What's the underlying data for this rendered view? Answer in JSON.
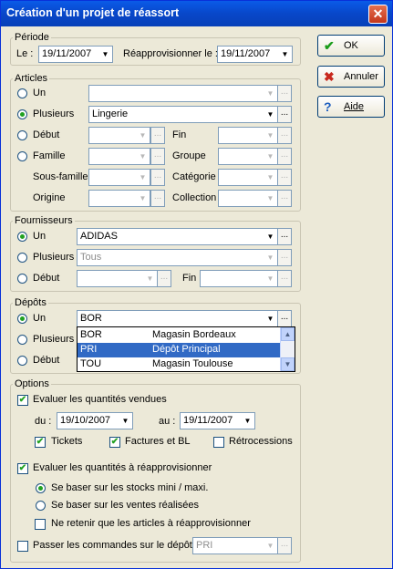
{
  "window": {
    "title": "Création d'un projet de réassort",
    "close_label": "✕"
  },
  "buttons": {
    "ok": "OK",
    "cancel": "Annuler",
    "help": "Aide"
  },
  "periode": {
    "title": "Période",
    "le_label": "Le :",
    "le_value": "19/11/2007",
    "reappro_label": "Réapprovisionner le :",
    "reappro_value": "19/11/2007"
  },
  "articles": {
    "title": "Articles",
    "un": "Un",
    "plusieurs": "Plusieurs",
    "plusieurs_value": "Lingerie",
    "debut": "Début",
    "fin": "Fin",
    "famille": "Famille",
    "groupe": "Groupe",
    "sous_famille": "Sous-famille",
    "categorie": "Catégorie",
    "origine": "Origine",
    "collection": "Collection",
    "selected": "plusieurs"
  },
  "fournisseurs": {
    "title": "Fournisseurs",
    "un": "Un",
    "un_value": "ADIDAS",
    "plusieurs": "Plusieurs",
    "plusieurs_value": "Tous",
    "debut": "Début",
    "fin": "Fin",
    "selected": "un"
  },
  "depots": {
    "title": "Dépôts",
    "un": "Un",
    "un_value": "BOR",
    "plusieurs": "Plusieurs",
    "debut": "Début",
    "selected": "un",
    "dropdown": [
      {
        "code": "BOR",
        "name": "Magasin Bordeaux",
        "selected": false
      },
      {
        "code": "PRI",
        "name": "Dépôt Principal",
        "selected": true
      },
      {
        "code": "TOU",
        "name": "Magasin Toulouse",
        "selected": false
      }
    ]
  },
  "options": {
    "title": "Options",
    "evaluer_vendues": "Evaluer les quantités vendues",
    "du_label": "du :",
    "du_value": "19/10/2007",
    "au_label": "au :",
    "au_value": "19/11/2007",
    "tickets": "Tickets",
    "factures": "Factures et BL",
    "retrocessions": "Rétrocessions",
    "evaluer_reappro": "Evaluer les quantités à réapprovisionner",
    "stocks_mini": "Se baser sur les stocks mini / maxi.",
    "ventes": "Se baser sur les ventes réalisées",
    "ne_retenir": "Ne retenir que les articles à réapprovisionner",
    "passer": "Passer les commandes sur le dépôt",
    "passer_value": "PRI"
  },
  "colors": {
    "title_blue": "#0a5be8",
    "selection": "#316ac5",
    "radio_green": "#21a121"
  }
}
